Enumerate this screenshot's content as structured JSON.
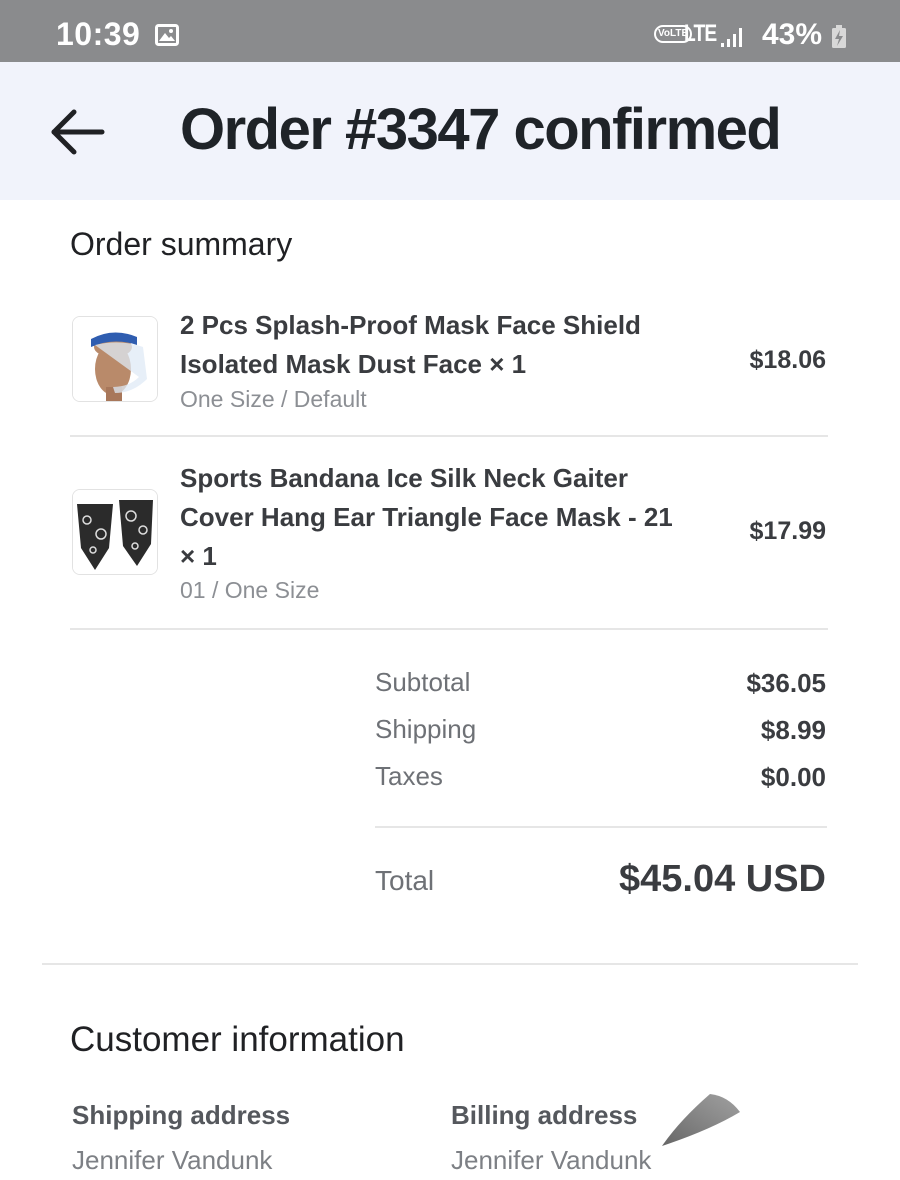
{
  "status_bar": {
    "time": "10:39",
    "network_badge": "VoLTE",
    "network_type": "LTE",
    "battery": "43%",
    "icons": [
      "gallery-icon",
      "signal-icon",
      "battery-charging-icon"
    ]
  },
  "header": {
    "title": "Order #3347 confirmed",
    "back_icon": "arrow-left-icon"
  },
  "order_summary": {
    "heading": "Order summary",
    "items": [
      {
        "title": "2 Pcs Splash-Proof Mask Face Shield Isolated Mask Dust Face × 1",
        "variant": "One Size / Default",
        "price": "$18.06",
        "thumb_icon": "face-shield-product-icon"
      },
      {
        "title": "Sports Bandana Ice Silk Neck Gaiter Cover Hang Ear Triangle Face Mask - 21 × 1",
        "variant": "01 / One Size",
        "price": "$17.99",
        "thumb_icon": "bandana-product-icon"
      }
    ],
    "subtotal_label": "Subtotal",
    "subtotal_value": "$36.05",
    "shipping_label": "Shipping",
    "shipping_value": "$8.99",
    "taxes_label": "Taxes",
    "taxes_value": "$0.00",
    "total_label": "Total",
    "total_value": "$45.04 USD"
  },
  "customer_info": {
    "heading": "Customer information",
    "shipping_address_label": "Shipping address",
    "shipping_name": "Jennifer Vandunk",
    "billing_address_label": "Billing address",
    "billing_name": "Jennifer Vandunk"
  },
  "colors": {
    "status_bar": "#8a8b8d",
    "header_bg": "#f1f3fb",
    "title_text": "#1f2328",
    "muted_text": "#8c8f94"
  }
}
